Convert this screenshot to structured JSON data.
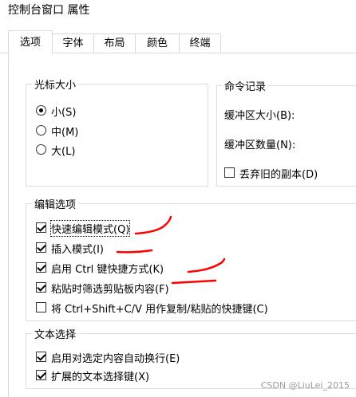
{
  "window": {
    "title": "控制台窗口 属性"
  },
  "tabs": [
    "选项",
    "字体",
    "布局",
    "颜色",
    "终端"
  ],
  "cursor_group": {
    "title": "光标大小",
    "options": [
      {
        "label": "小(S)",
        "checked": true
      },
      {
        "label": "中(M)",
        "checked": false
      },
      {
        "label": "大(L)",
        "checked": false
      }
    ]
  },
  "history_group": {
    "title": "命令记录",
    "buffer_size_label": "缓冲区大小(B):",
    "buffer_count_label": "缓冲区数量(N):",
    "discard_label": "丢弃旧的副本(D)",
    "discard_checked": false
  },
  "edit_group": {
    "title": "编辑选项",
    "items": [
      {
        "label": "快速编辑模式(Q)",
        "checked": true
      },
      {
        "label": "插入模式(I)",
        "checked": true
      },
      {
        "label": "启用 Ctrl 键快捷方式(K)",
        "checked": true
      },
      {
        "label": "粘贴时筛选剪贴板内容(F)",
        "checked": true
      },
      {
        "label": "将 Ctrl+Shift+C/V 用作复制/粘贴的快捷键(C)",
        "checked": false
      }
    ]
  },
  "text_group": {
    "title": "文本选择",
    "items": [
      {
        "label": "启用对选定内容自动换行(E)",
        "checked": true
      },
      {
        "label": "扩展的文本选择键(X)",
        "checked": true
      }
    ]
  },
  "annotation_color": "#ff0000",
  "watermark": "CSDN @LiuLei_2015"
}
